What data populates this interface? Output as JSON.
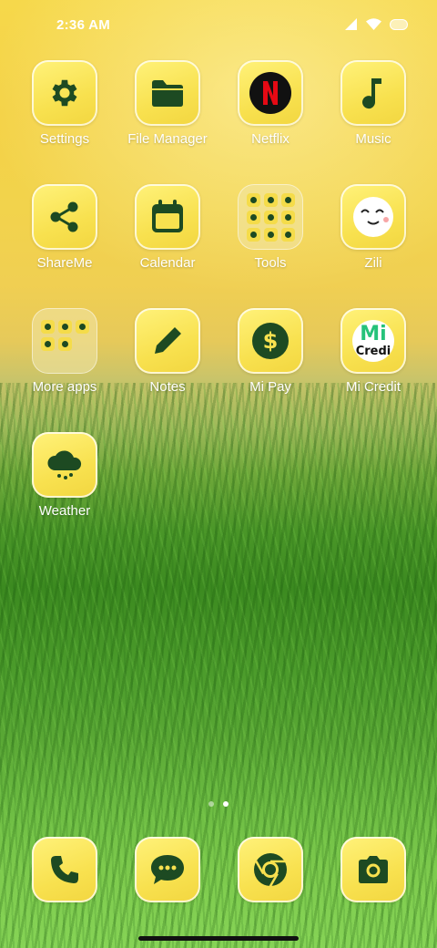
{
  "status_bar": {
    "time": "2:36 AM"
  },
  "apps": [
    {
      "label": "Settings",
      "icon": "gear-icon"
    },
    {
      "label": "File Manager",
      "icon": "folder-icon"
    },
    {
      "label": "Netflix",
      "icon": "netflix-icon"
    },
    {
      "label": "Music",
      "icon": "music-note-icon"
    },
    {
      "label": "ShareMe",
      "icon": "share-icon"
    },
    {
      "label": "Calendar",
      "icon": "calendar-icon"
    },
    {
      "label": "Tools",
      "icon": "tools-folder-icon"
    },
    {
      "label": "Zili",
      "icon": "zili-face-icon"
    },
    {
      "label": "More apps",
      "icon": "more-apps-folder-icon"
    },
    {
      "label": "Notes",
      "icon": "pencil-icon"
    },
    {
      "label": "Mi Pay",
      "icon": "dollar-icon"
    },
    {
      "label": "Mi Credit",
      "icon": "mi-credit-icon",
      "logo_text": "Mi",
      "logo_subtext": "Credi"
    },
    {
      "label": "Weather",
      "icon": "rain-cloud-icon"
    }
  ],
  "dock": [
    {
      "name": "Phone",
      "icon": "phone-icon"
    },
    {
      "name": "Messaging",
      "icon": "message-icon"
    },
    {
      "name": "Chrome",
      "icon": "chrome-icon"
    },
    {
      "name": "Camera",
      "icon": "camera-icon"
    }
  ],
  "page_indicator": {
    "pages": 2,
    "current": 2
  },
  "colors": {
    "icon_tile": "#f8e14f",
    "glyph": "#1d4a22",
    "label": "#ffffff"
  }
}
